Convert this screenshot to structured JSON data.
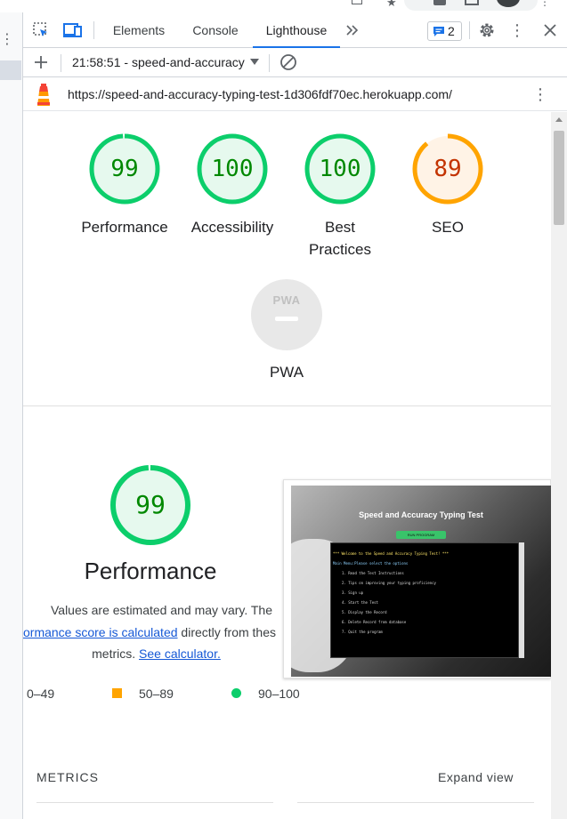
{
  "devtools": {
    "tabs": [
      {
        "label": "Elements"
      },
      {
        "label": "Console"
      },
      {
        "label": "Lighthouse"
      }
    ],
    "overflow_icon": "chevron-double-right-icon",
    "issues_count": "2",
    "report_selector": "21:58:51 - speed-and-accuracy",
    "url": "https://speed-and-accuracy-typing-test-1d306fdf70ec.herokuapp.com/"
  },
  "scores": [
    {
      "value": "99",
      "label": "Performance",
      "score": 99,
      "color": "#0cce6b",
      "text_color": "#008800",
      "fill": "#e6f9ee"
    },
    {
      "value": "100",
      "label": "Accessibility",
      "score": 100,
      "color": "#0cce6b",
      "text_color": "#008800",
      "fill": "#e6f9ee"
    },
    {
      "value": "100",
      "label_line1": "Best",
      "label_line2": "Practices",
      "score": 100,
      "color": "#0cce6b",
      "text_color": "#008800",
      "fill": "#e6f9ee"
    },
    {
      "value": "89",
      "label": "SEO",
      "score": 89,
      "color": "#ffa400",
      "text_color": "#c33300",
      "fill": "#fff3e6"
    }
  ],
  "pwa": {
    "badge": "PWA",
    "label": "PWA"
  },
  "performance_detail": {
    "score": "99",
    "title": "Performance",
    "desc_line1": "Values are estimated and may vary. The",
    "desc_link1": "ormance score is calculated",
    "desc_line2_rest": " directly from thes",
    "desc_line3": "metrics.",
    "desc_link2": "See calculator."
  },
  "legend": [
    {
      "range": "0–49",
      "color": "#ff4e42"
    },
    {
      "range": "50–89",
      "color": "#ffa400"
    },
    {
      "range": "90–100",
      "color": "#0cce6b"
    }
  ],
  "screenshot": {
    "title": "Speed and Accuracy Typing Test",
    "button": "RUN PROGRAM",
    "terminal_lines": [
      "*** Welcome to the Speed and Accuracy Typing Test! ***",
      "Main Menu:Please select the options",
      "1. Read the Test Instructions",
      "2. Tips on improving your typing proficiency",
      "3. Sign up",
      "4. Start the Test",
      "5. Display the Record",
      "6. Delete Record from database",
      "7. Quit the program"
    ]
  },
  "metrics": {
    "heading": "METRICS",
    "expand": "Expand view"
  }
}
